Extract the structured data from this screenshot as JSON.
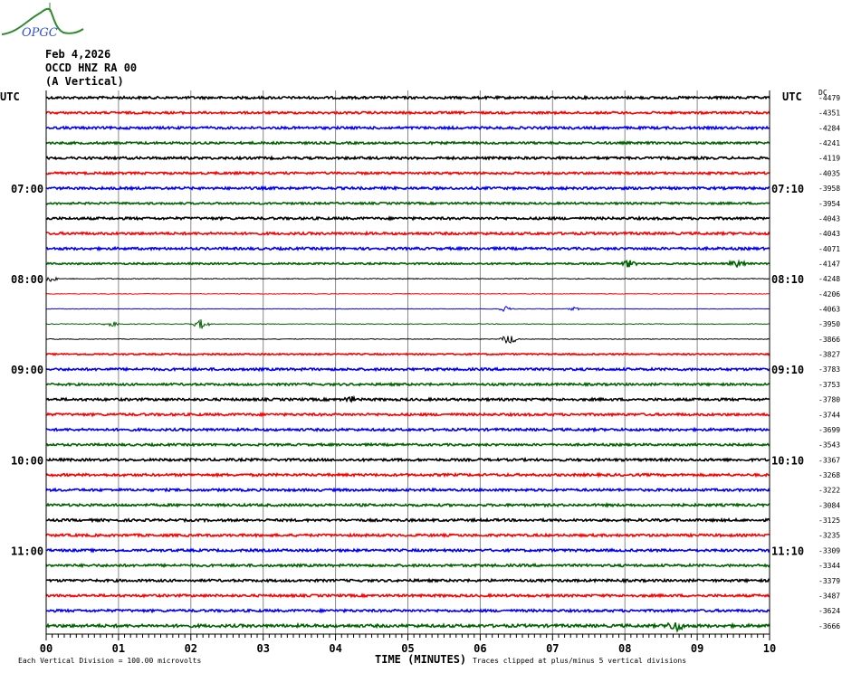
{
  "logo_text": "OPGC",
  "header": {
    "date": "Feb 4,2026",
    "station": "OCCD HNZ RA 00",
    "component": "(A Vertical)"
  },
  "left_axis_title": "UTC",
  "right_axis_title": "UTC",
  "dc_title": "DC",
  "footer": {
    "division_note": "Each Vertical Division =  100.00 microvolts",
    "xlabel": "TIME (MINUTES)",
    "clip_note": "Traces clipped at plus/minus 5 vertical divisions"
  },
  "chart_data": {
    "type": "line",
    "title": "OCCD HNZ RA 00 (A Vertical) helicorder, Feb 4,2026",
    "xlabel": "TIME (MINUTES)",
    "xlim": [
      0,
      10
    ],
    "x_ticks": [
      "00",
      "01",
      "02",
      "03",
      "04",
      "05",
      "06",
      "07",
      "08",
      "09",
      "10"
    ],
    "grid": true,
    "colors": [
      "#000000",
      "#ff0000",
      "#0000ff",
      "#006400"
    ],
    "left_labels": [
      {
        "row": 6,
        "text": "07:00"
      },
      {
        "row": 12,
        "text": "08:00"
      },
      {
        "row": 18,
        "text": "09:00"
      },
      {
        "row": 24,
        "text": "10:00"
      },
      {
        "row": 30,
        "text": "11:00"
      }
    ],
    "right_labels": [
      {
        "row": 6,
        "text": "07:10"
      },
      {
        "row": 12,
        "text": "08:10"
      },
      {
        "row": 18,
        "text": "09:10"
      },
      {
        "row": 24,
        "text": "10:10"
      },
      {
        "row": 30,
        "text": "11:10"
      }
    ],
    "dc_offsets": [
      -4479,
      -4351,
      -4284,
      -4241,
      -4119,
      -4035,
      -3958,
      -3954,
      -4043,
      -4043,
      -4071,
      -4147,
      -4248,
      -4206,
      -4063,
      -3950,
      -3866,
      -3827,
      -3783,
      -3753,
      -3780,
      -3744,
      -3699,
      -3543,
      -3367,
      -3268,
      -3222,
      -3084,
      -3125,
      -3235,
      -3309,
      -3344,
      -3379,
      -3487,
      -3624,
      -3666
    ],
    "noise_level": [
      1.0,
      0.9,
      1.0,
      0.9,
      1.0,
      0.9,
      1.0,
      0.8,
      1.0,
      1.0,
      1.0,
      0.7,
      0.4,
      0.3,
      0.2,
      0.3,
      0.3,
      0.6,
      1.0,
      0.9,
      1.0,
      1.0,
      1.0,
      0.9,
      1.0,
      1.0,
      1.0,
      1.0,
      1.0,
      1.0,
      1.0,
      1.0,
      1.0,
      1.0,
      1.0,
      1.2
    ],
    "events": [
      {
        "row": 11,
        "minute": 8.05,
        "amplitude": 4
      },
      {
        "row": 11,
        "minute": 9.55,
        "amplitude": 4
      },
      {
        "row": 12,
        "minute": 0.05,
        "amplitude": 4
      },
      {
        "row": 14,
        "minute": 6.35,
        "amplitude": 3
      },
      {
        "row": 14,
        "minute": 7.3,
        "amplitude": 2
      },
      {
        "row": 15,
        "minute": 0.9,
        "amplitude": 3
      },
      {
        "row": 15,
        "minute": 2.15,
        "amplitude": 6
      },
      {
        "row": 16,
        "minute": 6.4,
        "amplitude": 6
      },
      {
        "row": 20,
        "minute": 4.2,
        "amplitude": 3
      },
      {
        "row": 35,
        "minute": 8.7,
        "amplitude": 7
      }
    ]
  }
}
